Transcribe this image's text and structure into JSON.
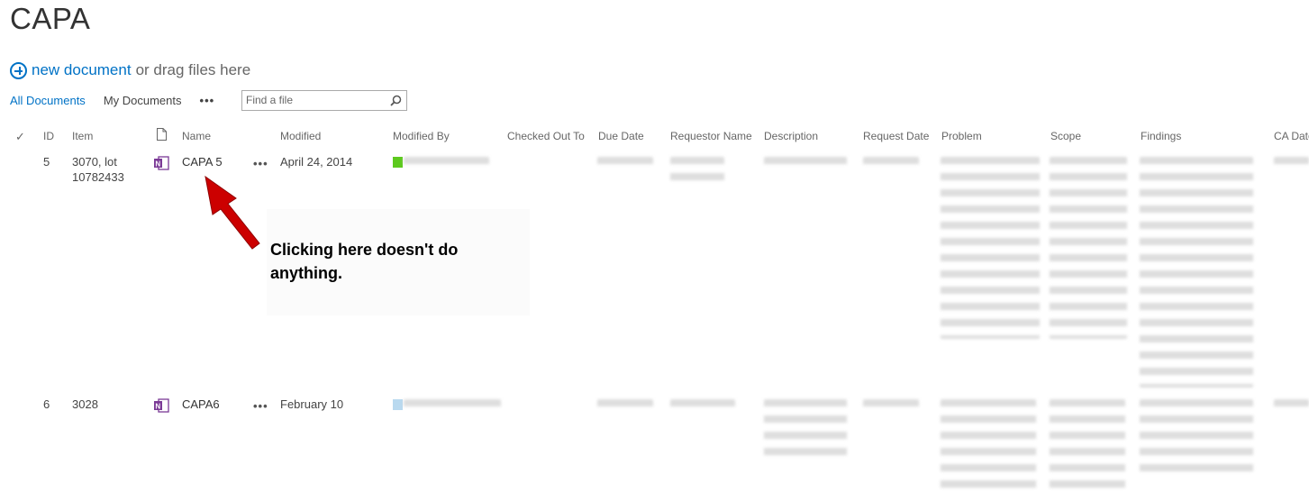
{
  "page": {
    "title": "CAPA"
  },
  "toolbar": {
    "new_document_label": "new document",
    "drag_text": "or drag files here"
  },
  "views": {
    "all_documents": "All Documents",
    "my_documents": "My Documents",
    "more": "•••"
  },
  "search": {
    "placeholder": "Find a file",
    "value": ""
  },
  "columns": {
    "check": "✓",
    "id": "ID",
    "item": "Item",
    "name": "Name",
    "modified": "Modified",
    "modified_by": "Modified By",
    "checked_out_to": "Checked Out To",
    "due_date": "Due Date",
    "requestor_name": "Requestor Name",
    "description": "Description",
    "request_date": "Request Date",
    "problem": "Problem",
    "scope": "Scope",
    "findings": "Findings",
    "ca_date": "CA Date"
  },
  "rows": [
    {
      "id": "5",
      "item_line1": "3070, lot",
      "item_line2": "10782433",
      "name": "CAPA 5",
      "ellipsis": "•••",
      "modified": "April 24, 2014"
    },
    {
      "id": "6",
      "item_line1": "3028",
      "item_line2": "",
      "name": "CAPA6",
      "ellipsis": "•••",
      "modified": "February 10"
    }
  ],
  "annotation": {
    "line1": "Clicking here doesn't do",
    "line2": "anything."
  },
  "colors": {
    "accent": "#0072c6",
    "onenote_icon": "#7b3a96",
    "arrow": "#cc0000",
    "presence_row1": "#5dc91e",
    "presence_row2": "#b9d9ef"
  },
  "icons": [
    "add-circle-icon",
    "search-icon",
    "document-icon",
    "onenote-icon",
    "presence-icon",
    "red-arrow"
  ]
}
